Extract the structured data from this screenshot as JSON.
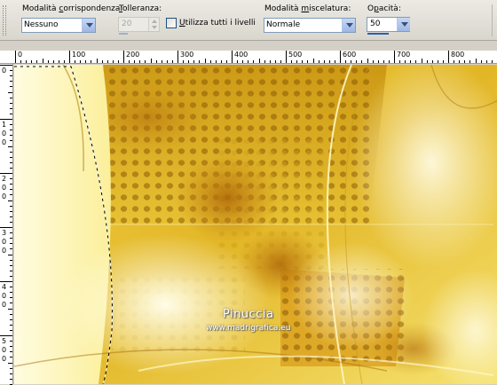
{
  "toolbar": {
    "match_mode": {
      "label_pre": "Modalità ",
      "label_ul": "c",
      "label_post": "orrispondenza:",
      "value": "Nessuno"
    },
    "tolerance": {
      "label_pre": "",
      "label_ul": "T",
      "label_post": "olleranza:",
      "value": "20",
      "disabled": true
    },
    "use_all_layers": {
      "label_pre": "",
      "label_ul": "U",
      "label_post": "tilizza tutti i livelli",
      "checked": false
    },
    "blend_mode": {
      "label_pre": "Modalità ",
      "label_ul": "m",
      "label_post": "iscelatura:",
      "value": "Normale"
    },
    "opacity": {
      "label_pre": "O",
      "label_ul": "p",
      "label_post": "acità:",
      "value": "50"
    }
  },
  "rulers": {
    "top": [
      "0",
      "100",
      "200",
      "300",
      "400",
      "500",
      "600",
      "700",
      "800"
    ],
    "left": [
      [
        "0"
      ],
      [
        "1",
        "0",
        "0"
      ],
      [
        "2",
        "0",
        "0"
      ],
      [
        "3",
        "0",
        "0"
      ],
      [
        "4",
        "0",
        "0"
      ],
      [
        "5",
        "0",
        "0"
      ]
    ]
  },
  "canvas": {
    "watermark_name": "Pinuccia",
    "watermark_url": "www.madrigrafica.eu",
    "colors": {
      "gold": "#d9ac1c",
      "dark_gold": "#a86f08",
      "light": "#fffbd0",
      "pale": "#fff7b8"
    }
  }
}
